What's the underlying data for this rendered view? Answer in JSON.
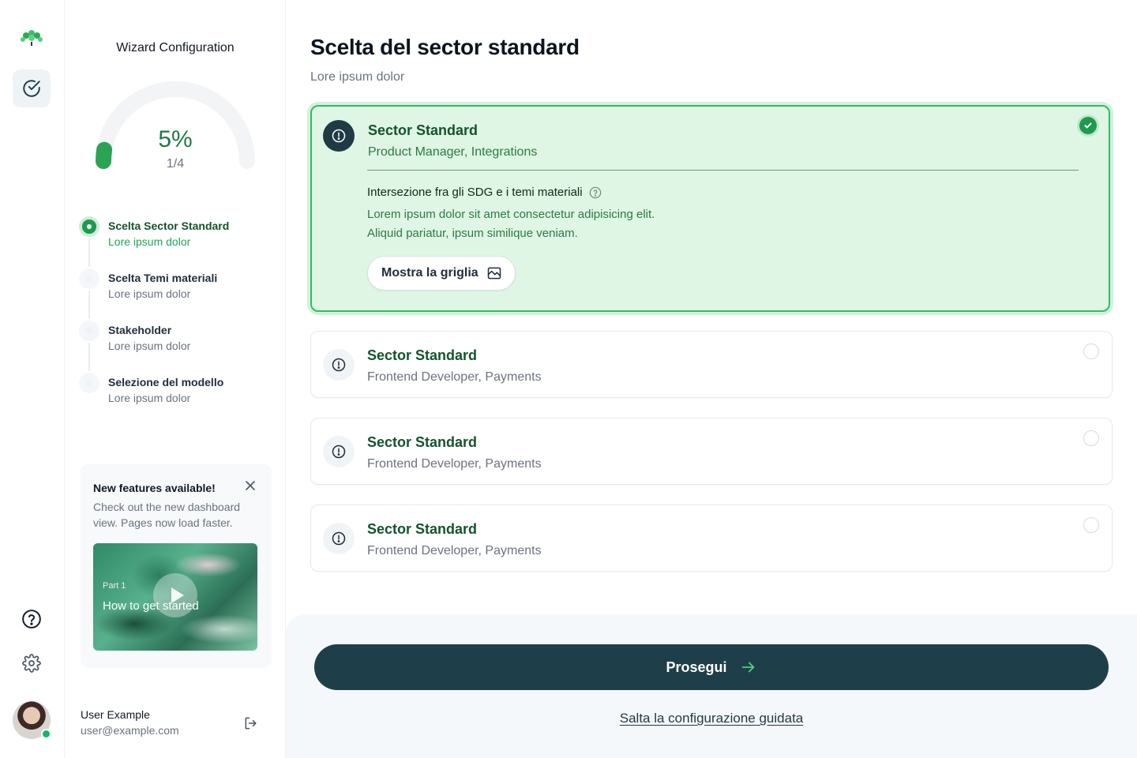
{
  "wizard": {
    "title": "Wizard Configuration",
    "progress_percent_label": "5%",
    "progress_fraction": 0.05,
    "step_counter": "1/4",
    "steps": [
      {
        "title": "Scelta Sector Standard",
        "subtitle": "Lore ipsum dolor",
        "status": "active"
      },
      {
        "title": "Scelta Temi materiali",
        "subtitle": "Lore ipsum dolor",
        "status": "pending"
      },
      {
        "title": "Stakeholder",
        "subtitle": "Lore ipsum dolor",
        "status": "pending"
      },
      {
        "title": "Selezione del modello",
        "subtitle": "Lore ipsum dolor",
        "status": "pending"
      }
    ]
  },
  "feature_card": {
    "title": "New features available!",
    "body": "Check out the new dashboard view. Pages now load faster.",
    "video_part": "Part 1",
    "video_title": "How to get started"
  },
  "user": {
    "name": "User Example",
    "email": "user@example.com"
  },
  "main": {
    "title": "Scelta del sector standard",
    "subtitle": "Lore ipsum dolor",
    "options": [
      {
        "title": "Sector Standard",
        "subtitle": "Product Manager, Integrations",
        "selected": true,
        "detail_heading": "Intersezione fra gli SDG e i temi materiali",
        "detail_line1": "Lorem ipsum dolor sit amet consectetur adipisicing elit.",
        "detail_line2": "Aliquid pariatur, ipsum similique veniam.",
        "grid_button": "Mostra la griglia"
      },
      {
        "title": "Sector Standard",
        "subtitle": "Frontend Developer, Payments",
        "selected": false
      },
      {
        "title": "Sector Standard",
        "subtitle": "Frontend Developer, Payments",
        "selected": false
      },
      {
        "title": "Sector Standard",
        "subtitle": "Frontend Developer, Payments",
        "selected": false
      }
    ],
    "continue_label": "Prosegui",
    "skip_label": "Salta la configurazione guidata"
  },
  "colors": {
    "accent_green": "#1e9a4f",
    "dark_teal": "#1e3f4a",
    "selected_bg": "#dff6e4"
  },
  "icons": [
    "logo-icon",
    "check-circle-icon",
    "help-icon",
    "gear-icon",
    "close-icon",
    "alert-circle-icon",
    "image-icon",
    "arrow-right-icon",
    "logout-icon"
  ]
}
